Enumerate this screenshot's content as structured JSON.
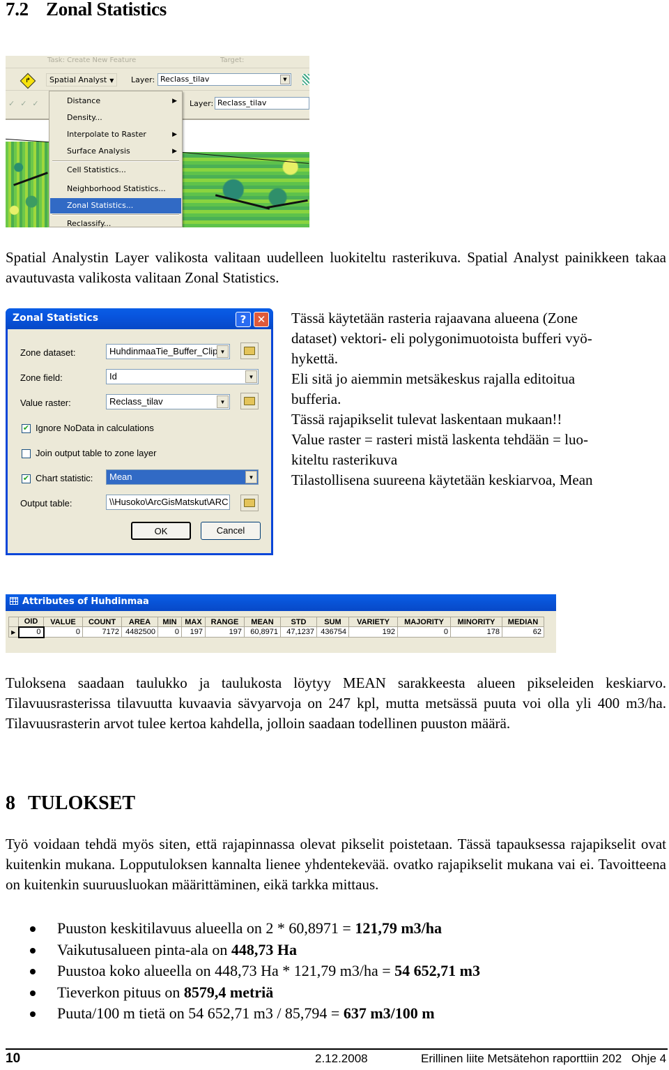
{
  "section": {
    "number": "7.2",
    "title": "Zonal Statistics"
  },
  "screenshot_toolbar": {
    "task_label": "Task:",
    "task_value": "Create New Feature",
    "target_label": "Target:",
    "spatial_analyst_button": "Spatial Analyst",
    "layer_label": "Layer:",
    "layer_value": "Reclass_tilav",
    "layer_label_2": "Layer:",
    "layer_value_2": "Reclass_tilav",
    "menu_items": [
      {
        "label": "Distance",
        "submenu": true
      },
      {
        "label": "Density...",
        "submenu": false
      },
      {
        "label": "Interpolate to Raster",
        "submenu": true
      },
      {
        "label": "Surface Analysis",
        "submenu": true
      },
      {
        "label": "Cell Statistics...",
        "submenu": false
      },
      {
        "label": "Neighborhood Statistics...",
        "submenu": false
      },
      {
        "label": "Zonal Statistics...",
        "submenu": false,
        "selected": true
      },
      {
        "label": "Reclassify...",
        "submenu": false
      }
    ]
  },
  "paragraph_1": "Spatial Analystin Layer valikosta valitaan uudelleen luokiteltu rasterikuva. Spatial Analyst painikkeen takaa avautuvasta valikosta valitaan Zonal Statistics.",
  "dialog": {
    "title": "Zonal Statistics",
    "help": "?",
    "close": "✕",
    "zone_dataset_label": "Zone dataset:",
    "zone_dataset_value": "HuhdinmaaTie_Buffer_Clip",
    "zone_field_label": "Zone field:",
    "zone_field_value": "Id",
    "value_raster_label": "Value raster:",
    "value_raster_value": "Reclass_tilav",
    "ignore_nodata_label": "Ignore NoData in calculations",
    "ignore_nodata_checked": true,
    "join_output_label": "Join output table to zone layer",
    "join_output_checked": false,
    "chart_statistic_label": "Chart statistic:",
    "chart_statistic_checked": true,
    "chart_statistic_value": "Mean",
    "output_table_label": "Output table:",
    "output_table_value": "\\\\Husoko\\ArcGisMatskut\\ARC",
    "ok_label": "OK",
    "cancel_label": "Cancel"
  },
  "side_notes": [
    "Tässä käytetään rasteria rajaavana alueena (Zone",
    "dataset) vektori- eli polygonimuotoista bufferi vyö-",
    "hykettä.",
    "Eli sitä jo aiemmin metsäkeskus rajalla editoitua",
    "bufferia.",
    "Tässä rajapikselit tulevat laskentaan mukaan!!",
    "Value raster = rasteri mistä laskenta tehdään = luo-",
    "kiteltu rasterikuva",
    "Tilastollisena suureena käytetään keskiarvoa, Mean"
  ],
  "attributes_table": {
    "title": "Attributes of Huhdinmaa",
    "columns": [
      "OID",
      "VALUE",
      "COUNT",
      "AREA",
      "MIN",
      "MAX",
      "RANGE",
      "MEAN",
      "STD",
      "SUM",
      "VARIETY",
      "MAJORITY",
      "MINORITY",
      "MEDIAN"
    ],
    "rows": [
      [
        "0",
        "0",
        "7172",
        "4482500",
        "0",
        "197",
        "197",
        "60,8971",
        "47,1237",
        "436754",
        "192",
        "0",
        "178",
        "62"
      ]
    ]
  },
  "paragraph_2": "Tuloksena saadaan taulukko ja taulukosta löytyy MEAN sarakkeesta alueen pikseleiden keskiarvo. Tilavuusrasterissa tilavuutta kuvaavia sävyarvoja on 247 kpl, mutta metsässä puuta voi olla yli 400 m3/ha. Tilavuusrasterin arvot tulee kertoa kahdella, jolloin saadaan todellinen puuston määrä.",
  "chapter": {
    "number": "8",
    "title": "TULOKSET"
  },
  "paragraph_3": "Työ voidaan tehdä myös siten, että rajapinnassa olevat pikselit poistetaan. Tässä tapauksessa rajapikselit ovat kuitenkin mukana. Lopputuloksen kannalta lienee yhdentekevää. ovatko rajapikselit mukana vai ei. Tavoitteena on kuitenkin suuruusluokan määrittäminen, eikä tarkka mittaus.",
  "results": [
    {
      "text": "Puuston keskitilavuus alueella on 2 * 60,8971 = ",
      "bold": "121,79 m3/ha"
    },
    {
      "text": "Vaikutusalueen pinta-ala on ",
      "bold": "448,73 Ha"
    },
    {
      "text": "Puustoa koko alueella on 448,73 Ha * 121,79 m3/ha = ",
      "bold": "54 652,71 m3"
    },
    {
      "text": "Tieverkon pituus on ",
      "bold": "8579,4 metriä"
    },
    {
      "text": "Puuta/100 m tietä on 54 652,71 m3 / 85,794 = ",
      "bold": "637 m3/100 m"
    }
  ],
  "footer": {
    "page_number": "10",
    "date": "2.12.2008",
    "reference": "Erillinen liite Metsätehon raporttiin 202",
    "guide": "Ohje 4"
  }
}
